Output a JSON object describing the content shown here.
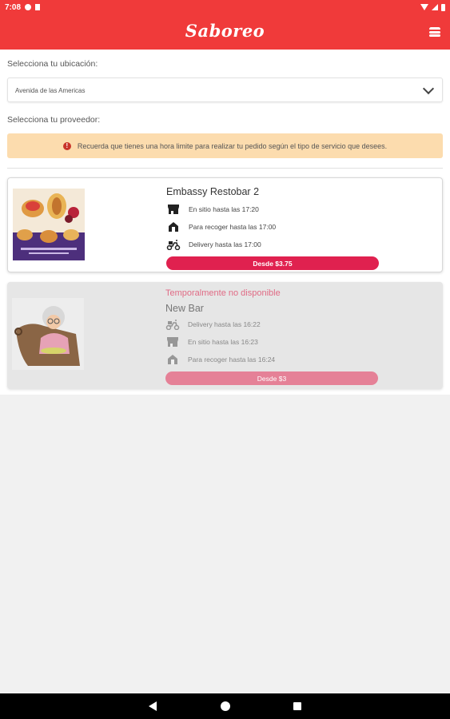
{
  "status_bar": {
    "time": "7:08",
    "icons": [
      "notification-g-icon",
      "sd-card-icon",
      "wifi-icon",
      "signal-icon",
      "battery-icon"
    ]
  },
  "app_bar": {
    "brand": "Saboreo",
    "menu_icon": "burger-menu-icon",
    "color": "#f03a3a"
  },
  "location": {
    "label": "Selecciona tu ubicación:",
    "selected": "Avenida de las Americas"
  },
  "provider": {
    "label": "Selecciona tu proveedor:"
  },
  "alert": {
    "icon": "alert-circle-icon",
    "text": "Recuerda que tienes una hora limite para realizar tu pedido según el tipo de servicio que desees."
  },
  "providers": [
    {
      "name": "Embassy Restobar 2",
      "services": [
        {
          "icon": "store-icon",
          "text": "En sitio hasta las 17:20"
        },
        {
          "icon": "pickup-house-icon",
          "text": "Para recoger hasta las 17:00"
        },
        {
          "icon": "scooter-icon",
          "text": "Delivery hasta las 17:00"
        }
      ],
      "price_label": "Desde $3.75"
    },
    {
      "unavailable_label": "Temporalmente no disponible",
      "name": "New Bar",
      "services": [
        {
          "icon": "scooter-icon",
          "text": "Delivery hasta las 16:22"
        },
        {
          "icon": "store-icon",
          "text": "En sitio hasta las 16:23"
        },
        {
          "icon": "pickup-house-icon",
          "text": "Para recoger hasta las 16:24"
        }
      ],
      "price_label": "Desde $3"
    }
  ],
  "colors": {
    "primary": "#f03a3a",
    "price_button": "#e0214f",
    "price_button_disabled": "#e58197",
    "alert_bg": "#fcdcae",
    "unavailable_text": "#e06b85"
  },
  "nav": {
    "back_icon": "nav-back-icon",
    "home_icon": "nav-home-icon",
    "recents_icon": "nav-recents-icon"
  }
}
